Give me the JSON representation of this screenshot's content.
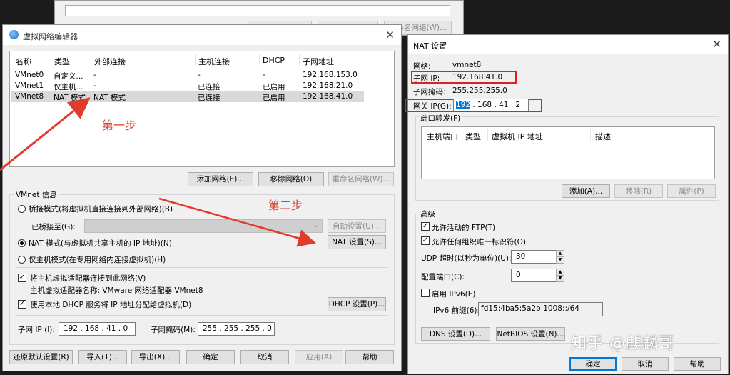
{
  "background_window": {
    "buttons": [
      "添加网络(E)...",
      "移除网络(O)",
      "重命名网络(W)..."
    ]
  },
  "vne": {
    "title": "虚拟网络编辑器",
    "columns": [
      "名称",
      "类型",
      "外部连接",
      "主机连接",
      "DHCP",
      "子网地址"
    ],
    "rows": [
      {
        "name": "VMnet0",
        "type": "自定义...",
        "external": "-",
        "host": "-",
        "dhcp": "-",
        "subnet": "192.168.153.0"
      },
      {
        "name": "VMnet1",
        "type": "仅主机...",
        "external": "-",
        "host": "已连接",
        "dhcp": "已启用",
        "subnet": "192.168.21.0"
      },
      {
        "name": "VMnet8",
        "type": "NAT 模式",
        "external": "NAT 模式",
        "host": "已连接",
        "dhcp": "已启用",
        "subnet": "192.168.41.0"
      }
    ],
    "add_network": "添加网络(E)...",
    "remove_network": "移除网络(O)",
    "rename_network": "重命名网络(W)...",
    "vmnet_info": "VMnet 信息",
    "bridge_mode": "桥接模式(将虚拟机直接连接到外部网络)(B)",
    "bridged_to": "已桥接至(G):",
    "auto_settings": "自动设置(U)...",
    "nat_mode": "NAT 模式(与虚拟机共享主机的 IP 地址)(N)",
    "nat_settings": "NAT 设置(S)...",
    "host_only": "仅主机模式(在专用网络内连接虚拟机)(H)",
    "connect_adapter": "将主机虚拟适配器连接到此网络(V)",
    "adapter_name": "主机虚拟适配器名称: VMware 网络适配器 VMnet8",
    "use_dhcp": "使用本地 DHCP 服务将 IP 地址分配给虚拟机(D)",
    "dhcp_settings": "DHCP 设置(P)...",
    "subnet_ip_label": "子网 IP (I):",
    "subnet_ip": "192 . 168 . 41 . 0",
    "subnet_mask_label": "子网掩码(M):",
    "subnet_mask": "255 . 255 . 255 . 0",
    "restore_defaults": "还原默认设置(R)",
    "import": "导入(T)...",
    "export": "导出(X)...",
    "ok": "确定",
    "cancel": "取消",
    "apply": "应用(A)",
    "help": "帮助"
  },
  "annotations": {
    "step1": "第一步",
    "step2": "第二步"
  },
  "nat": {
    "title": "NAT 设置",
    "network_label": "网络:",
    "network_value": "vmnet8",
    "subnet_ip_label": "子网 IP:",
    "subnet_ip_value": "192.168.41.0",
    "subnet_mask_label": "子网掩码:",
    "subnet_mask_value": "255.255.255.0",
    "gateway_label": "网关 IP(G):",
    "gateway_sel": "192",
    "gateway_rest": " . 168 . 41 . 2",
    "port_forward_label": "端口转发(F)",
    "pf_columns": [
      "主机端口",
      "类型",
      "虚拟机 IP 地址",
      "描述"
    ],
    "pf_add": "添加(A)...",
    "pf_remove": "移除(R)",
    "pf_props": "属性(P)",
    "advanced": "高级",
    "allow_ftp": "允许活动的 FTP(T)",
    "allow_uid": "允许任何组织唯一标识符(O)",
    "udp_timeout_label": "UDP 超时(以秒为单位)(U):",
    "udp_timeout": "30",
    "config_port_label": "配置端口(C):",
    "config_port": "0",
    "enable_ipv6": "启用 IPv6(E)",
    "ipv6_prefix_label": "IPv6 前缀(6):",
    "ipv6_prefix": "fd15:4ba5:5a2b:1008::/64",
    "dns_settings": "DNS 设置(D)...",
    "netbios_settings": "NetBIOS 设置(N)...",
    "ok": "确定",
    "cancel": "取消",
    "help": "帮助"
  },
  "watermark": "知乎 @麒麟哥",
  "colors": {
    "annotation_red": "#e23b2b",
    "selection_blue": "#0078d7"
  }
}
